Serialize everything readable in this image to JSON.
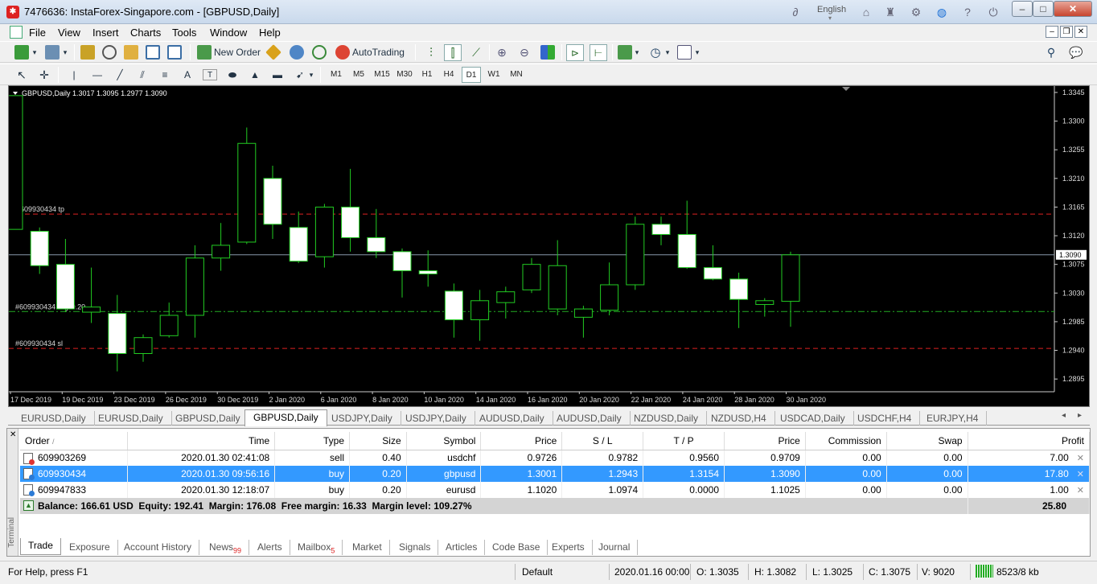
{
  "window": {
    "title": "7476636: InstaForex-Singapore.com - [GBPUSD,Daily]",
    "language": "English",
    "minimize": "–",
    "maximize": "□",
    "close": "✕"
  },
  "menu": [
    "File",
    "View",
    "Insert",
    "Charts",
    "Tools",
    "Window",
    "Help"
  ],
  "toolbar": {
    "new_order": "New Order",
    "auto_trading": "AutoTrading",
    "timeframes": [
      "M1",
      "M5",
      "M15",
      "M30",
      "H1",
      "H4",
      "D1",
      "W1",
      "MN"
    ],
    "active_timeframe": "D1"
  },
  "chart": {
    "header": "GBPUSD,Daily  1.3017 1.3095 1.2977 1.3090",
    "labels": {
      "tp": "609930434 tp",
      "entry": "#609930434 buy 0.20",
      "sl": "#609930434 sl"
    },
    "current_price": "1.3090"
  },
  "chart_data": {
    "type": "candlestick",
    "symbol": "GBPUSD",
    "timeframe": "Daily",
    "ylim": [
      1.2875,
      1.3355
    ],
    "y_ticks": [
      "1.3345",
      "1.3300",
      "1.3255",
      "1.3210",
      "1.3165",
      "1.3120",
      "1.3075",
      "1.3030",
      "1.2985",
      "1.2940",
      "1.2895"
    ],
    "x_ticks": [
      "17 Dec 2019",
      "19 Dec 2019",
      "23 Dec 2019",
      "26 Dec 2019",
      "30 Dec 2019",
      "2 Jan 2020",
      "6 Jan 2020",
      "8 Jan 2020",
      "10 Jan 2020",
      "14 Jan 2020",
      "16 Jan 2020",
      "20 Jan 2020",
      "22 Jan 2020",
      "24 Jan 2020",
      "28 Jan 2020",
      "30 Jan 2020"
    ],
    "levels": {
      "tp": 1.3154,
      "entry": 1.3001,
      "sl": 1.2943,
      "bid": 1.309
    },
    "candles": [
      {
        "o": 1.313,
        "h": 1.334,
        "l": 1.313,
        "c": 1.334
      },
      {
        "o": 1.3127,
        "h": 1.3133,
        "l": 1.306,
        "c": 1.3073
      },
      {
        "o": 1.3075,
        "h": 1.3115,
        "l": 1.3,
        "c": 1.3005
      },
      {
        "o": 1.3,
        "h": 1.307,
        "l": 1.2983,
        "c": 1.3008
      },
      {
        "o": 1.2998,
        "h": 1.3027,
        "l": 1.2907,
        "c": 1.2935
      },
      {
        "o": 1.2935,
        "h": 1.2965,
        "l": 1.2922,
        "c": 1.296
      },
      {
        "o": 1.2963,
        "h": 1.3015,
        "l": 1.296,
        "c": 1.2995
      },
      {
        "o": 1.2995,
        "h": 1.3105,
        "l": 1.296,
        "c": 1.3085
      },
      {
        "o": 1.3085,
        "h": 1.314,
        "l": 1.3065,
        "c": 1.3105
      },
      {
        "o": 1.311,
        "h": 1.329,
        "l": 1.3107,
        "c": 1.3265
      },
      {
        "o": 1.321,
        "h": 1.323,
        "l": 1.3115,
        "c": 1.3138
      },
      {
        "o": 1.3133,
        "h": 1.3158,
        "l": 1.3077,
        "c": 1.308
      },
      {
        "o": 1.3087,
        "h": 1.317,
        "l": 1.307,
        "c": 1.3165
      },
      {
        "o": 1.3165,
        "h": 1.3225,
        "l": 1.3095,
        "c": 1.3117
      },
      {
        "o": 1.3117,
        "h": 1.3162,
        "l": 1.3085,
        "c": 1.3095
      },
      {
        "o": 1.3095,
        "h": 1.31,
        "l": 1.3023,
        "c": 1.3065
      },
      {
        "o": 1.3065,
        "h": 1.3097,
        "l": 1.304,
        "c": 1.306
      },
      {
        "o": 1.3033,
        "h": 1.3045,
        "l": 1.296,
        "c": 1.2988
      },
      {
        "o": 1.2988,
        "h": 1.3035,
        "l": 1.2955,
        "c": 1.3018
      },
      {
        "o": 1.3015,
        "h": 1.304,
        "l": 1.299,
        "c": 1.3032
      },
      {
        "o": 1.3035,
        "h": 1.3085,
        "l": 1.303,
        "c": 1.3075
      },
      {
        "o": 1.3005,
        "h": 1.3113,
        "l": 1.2995,
        "c": 1.3073
      },
      {
        "o": 1.2992,
        "h": 1.301,
        "l": 1.296,
        "c": 1.3005
      },
      {
        "o": 1.3003,
        "h": 1.3078,
        "l": 1.2995,
        "c": 1.3043
      },
      {
        "o": 1.3043,
        "h": 1.315,
        "l": 1.3035,
        "c": 1.3138
      },
      {
        "o": 1.3138,
        "h": 1.315,
        "l": 1.3105,
        "c": 1.3122
      },
      {
        "o": 1.3122,
        "h": 1.3175,
        "l": 1.3068,
        "c": 1.307
      },
      {
        "o": 1.307,
        "h": 1.3105,
        "l": 1.305,
        "c": 1.3052
      },
      {
        "o": 1.3052,
        "h": 1.3062,
        "l": 1.2975,
        "c": 1.302
      },
      {
        "o": 1.3012,
        "h": 1.3022,
        "l": 1.2993,
        "c": 1.3018
      },
      {
        "o": 1.3017,
        "h": 1.3095,
        "l": 1.2977,
        "c": 1.309
      }
    ]
  },
  "chart_tabs": [
    "EURUSD,Daily",
    "EURUSD,Daily",
    "GBPUSD,Daily",
    "GBPUSD,Daily",
    "USDJPY,Daily",
    "USDJPY,Daily",
    "AUDUSD,Daily",
    "AUDUSD,Daily",
    "NZDUSD,Daily",
    "NZDUSD,H4",
    "USDCAD,Daily",
    "USDCHF,H4",
    "EURJPY,H4"
  ],
  "active_chart_tab": 3,
  "terminal": {
    "side_label": "Terminal",
    "columns": [
      "Order",
      "Time",
      "Type",
      "Size",
      "Symbol",
      "Price",
      "S / L",
      "T / P",
      "Price",
      "Commission",
      "Swap",
      "Profit"
    ],
    "rows": [
      [
        "609903269",
        "2020.01.30 02:41:08",
        "sell",
        "0.40",
        "usdchf",
        "0.9726",
        "0.9782",
        "0.9560",
        "0.9709",
        "0.00",
        "0.00",
        "7.00"
      ],
      [
        "609930434",
        "2020.01.30 09:56:16",
        "buy",
        "0.20",
        "gbpusd",
        "1.3001",
        "1.2943",
        "1.3154",
        "1.3090",
        "0.00",
        "0.00",
        "17.80"
      ],
      [
        "609947833",
        "2020.01.30 12:18:07",
        "buy",
        "0.20",
        "eurusd",
        "1.1020",
        "1.0974",
        "0.0000",
        "1.1025",
        "0.00",
        "0.00",
        "1.00"
      ]
    ],
    "selected_row": 1,
    "balance_line": "Balance: 166.61 USD  Equity: 192.41  Margin: 176.08  Free margin: 16.33  Margin level: 109.27%",
    "total_profit": "25.80",
    "tabs": [
      "Trade",
      "Exposure",
      "Account History",
      "News",
      "Alerts",
      "Mailbox",
      "Market",
      "Signals",
      "Articles",
      "Code Base",
      "Experts",
      "Journal"
    ],
    "news_badge": "99",
    "mailbox_badge": "5"
  },
  "status": {
    "help": "For Help, press F1",
    "profile": "Default",
    "datetime": "2020.01.16 00:00",
    "open": "O: 1.3035",
    "high": "H: 1.3082",
    "low": "L: 1.3025",
    "close": "C: 1.3075",
    "volume": "V: 9020",
    "traffic": "8523/8 kb"
  }
}
